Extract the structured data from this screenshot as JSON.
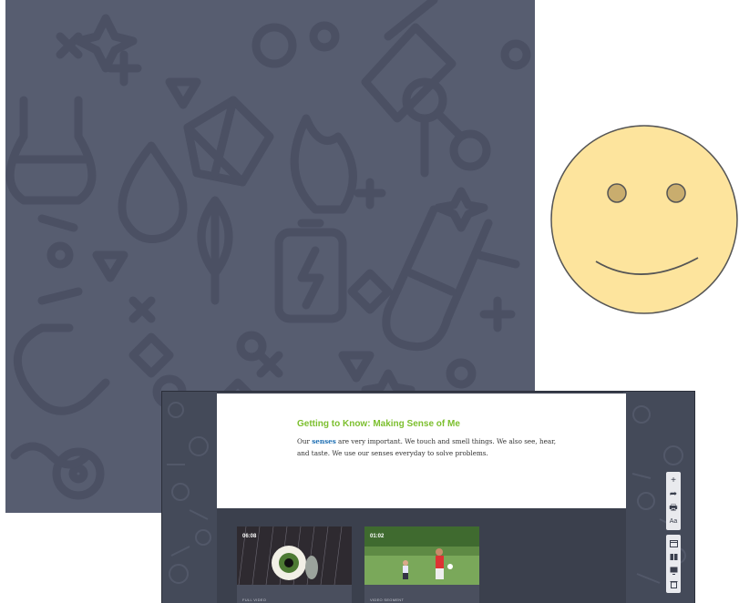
{
  "lesson": {
    "title": "Getting to Know: Making Sense of Me",
    "body_prefix": "Our ",
    "body_keyword": "senses",
    "body_suffix": " are very important. We touch and smell things. We also see, hear, and taste.  We use our senses everyday to solve problems."
  },
  "videos": [
    {
      "duration": "06:08",
      "caption": "FULL VIDEO"
    },
    {
      "duration": "01:02",
      "caption": "VIDEO SEGMENT"
    }
  ],
  "toolbar": {
    "add": "+",
    "share": "➦",
    "print": "🖶",
    "text_size": "Aa"
  },
  "colors": {
    "pattern_bg": "#575d70",
    "title_green": "#7cbf2e",
    "keyword_blue": "#1e6fb3",
    "smiley_face": "#fde49d"
  }
}
